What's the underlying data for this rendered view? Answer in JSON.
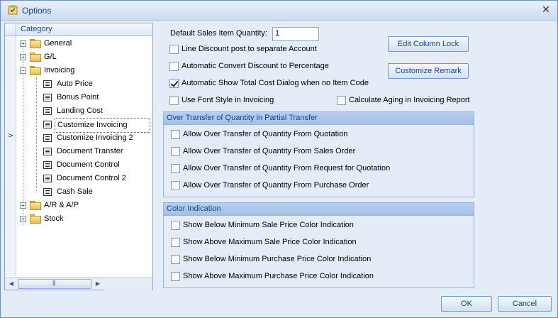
{
  "window": {
    "title": "Options"
  },
  "category": {
    "header": "Category",
    "items": [
      {
        "label": "General",
        "type": "folder",
        "state": "collapsed"
      },
      {
        "label": "G/L",
        "type": "folder",
        "state": "collapsed"
      },
      {
        "label": "Invoicing",
        "type": "folder",
        "state": "expanded"
      },
      {
        "label": "Auto Price",
        "type": "leaf"
      },
      {
        "label": "Bonus Point",
        "type": "leaf"
      },
      {
        "label": "Landing Cost",
        "type": "leaf"
      },
      {
        "label": "Customize Invoicing",
        "type": "leaf",
        "selected": true
      },
      {
        "label": "Customize Invoicing 2",
        "type": "leaf"
      },
      {
        "label": "Document Transfer",
        "type": "leaf"
      },
      {
        "label": "Document Control",
        "type": "leaf"
      },
      {
        "label": "Document Control 2",
        "type": "leaf"
      },
      {
        "label": "Cash Sale",
        "type": "leaf"
      },
      {
        "label": "A/R & A/P",
        "type": "folder",
        "state": "collapsed"
      },
      {
        "label": "Stock",
        "type": "folder",
        "state": "collapsed"
      }
    ]
  },
  "settings": {
    "default_qty_label": "Default Sales Item Quantity:",
    "default_qty_value": "1",
    "line_discount": {
      "label": "Line Discount post to separate Account",
      "checked": false
    },
    "auto_convert": {
      "label": "Automatic Convert Discount to Percentage",
      "checked": false
    },
    "auto_show_cost": {
      "label": "Automatic Show Total Cost Dialog when no Item Code",
      "checked": true
    },
    "font_style": {
      "label": "Use Font Style in Invoicing",
      "checked": false
    },
    "calc_aging": {
      "label": "Calculate Aging in Invoicing Report",
      "checked": false
    },
    "edit_column_lock": "Edit Column Lock",
    "customize_remark": "Customize Remark"
  },
  "over_transfer": {
    "title": "Over Transfer of Quantity in Partial Transfer",
    "items": [
      "Allow Over Transfer of Quantity From Quotation",
      "Allow Over Transfer of Quantity From Sales Order",
      "Allow Over Transfer of Quantity From Request for Quotation",
      "Allow Over Transfer of Quantity From Purchase Order"
    ]
  },
  "color_indication": {
    "title": "Color Indication",
    "items": [
      "Show Below Minimum Sale Price Color Indication",
      "Show Above Maximum Sale Price Color Indication",
      "Show Below Minimum Purchase Price Color Indication",
      "Show Above Maximum Purchase Price Color Indication"
    ]
  },
  "footer": {
    "ok": "OK",
    "cancel": "Cancel"
  },
  "colors": {
    "accent": "#15428b",
    "group_header": "#a4bfe6"
  },
  "icons": {
    "title": "options-app-icon",
    "close": "close-icon",
    "folder": "folder-icon",
    "leaf": "document-icon"
  }
}
